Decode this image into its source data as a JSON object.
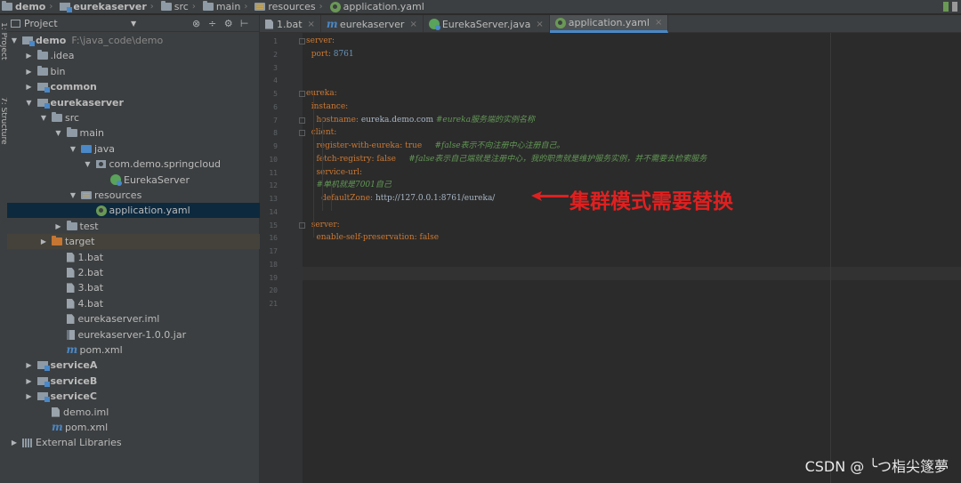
{
  "breadcrumb": [
    {
      "label": "demo",
      "icon": "folder-icon",
      "bold": true
    },
    {
      "label": "eurekaserver",
      "icon": "module-folder-icon",
      "bold": true
    },
    {
      "label": "src",
      "icon": "folder-icon",
      "bold": false
    },
    {
      "label": "main",
      "icon": "folder-icon",
      "bold": false
    },
    {
      "label": "resources",
      "icon": "resources-folder-icon",
      "bold": false
    },
    {
      "label": "application.yaml",
      "icon": "yaml-file-icon",
      "bold": false
    }
  ],
  "tool_strip": {
    "project_label": "1: Project",
    "structure_label": "7: Structure"
  },
  "project_panel": {
    "title": "Project",
    "tree": [
      {
        "label": "demo",
        "path": "F:\\java_code\\demo",
        "depth": 0,
        "arrow": "open",
        "icon": "module-folder-icon",
        "bold": true
      },
      {
        "label": ".idea",
        "depth": 1,
        "arrow": "closed",
        "icon": "folder-icon"
      },
      {
        "label": "bin",
        "depth": 1,
        "arrow": "closed",
        "icon": "folder-icon"
      },
      {
        "label": "common",
        "depth": 1,
        "arrow": "closed",
        "icon": "module-folder-icon",
        "bold": true
      },
      {
        "label": "eurekaserver",
        "depth": 1,
        "arrow": "open",
        "icon": "module-folder-icon",
        "bold": true
      },
      {
        "label": "src",
        "depth": 2,
        "arrow": "open",
        "icon": "folder-icon"
      },
      {
        "label": "main",
        "depth": 3,
        "arrow": "open",
        "icon": "folder-icon"
      },
      {
        "label": "java",
        "depth": 4,
        "arrow": "open",
        "icon": "java-source-folder-icon"
      },
      {
        "label": "com.demo.springcloud",
        "depth": 5,
        "arrow": "open",
        "icon": "package-icon"
      },
      {
        "label": "EurekaServer",
        "depth": 6,
        "arrow": "none",
        "icon": "spring-class-icon"
      },
      {
        "label": "resources",
        "depth": 4,
        "arrow": "open",
        "icon": "resources-folder-icon"
      },
      {
        "label": "application.yaml",
        "depth": 5,
        "arrow": "none",
        "icon": "yaml-file-icon",
        "selected": true
      },
      {
        "label": "test",
        "depth": 3,
        "arrow": "closed",
        "icon": "folder-icon"
      },
      {
        "label": "target",
        "depth": 2,
        "arrow": "closed",
        "icon": "excluded-folder-icon",
        "excluded": true
      },
      {
        "label": "1.bat",
        "depth": 3,
        "arrow": "none",
        "icon": "file-icon"
      },
      {
        "label": "2.bat",
        "depth": 3,
        "arrow": "none",
        "icon": "file-icon"
      },
      {
        "label": "3.bat",
        "depth": 3,
        "arrow": "none",
        "icon": "file-icon"
      },
      {
        "label": "4.bat",
        "depth": 3,
        "arrow": "none",
        "icon": "file-icon"
      },
      {
        "label": "eurekaserver.iml",
        "depth": 3,
        "arrow": "none",
        "icon": "iml-file-icon"
      },
      {
        "label": "eurekaserver-1.0.0.jar",
        "depth": 3,
        "arrow": "none",
        "icon": "jar-file-icon"
      },
      {
        "label": "pom.xml",
        "depth": 3,
        "arrow": "none",
        "icon": "maven-icon"
      },
      {
        "label": "serviceA",
        "depth": 1,
        "arrow": "closed",
        "icon": "module-folder-icon",
        "bold": true
      },
      {
        "label": "serviceB",
        "depth": 1,
        "arrow": "closed",
        "icon": "module-folder-icon",
        "bold": true
      },
      {
        "label": "serviceC",
        "depth": 1,
        "arrow": "closed",
        "icon": "module-folder-icon",
        "bold": true
      },
      {
        "label": "demo.iml",
        "depth": 2,
        "arrow": "none",
        "icon": "iml-file-icon"
      },
      {
        "label": "pom.xml",
        "depth": 2,
        "arrow": "none",
        "icon": "maven-icon"
      },
      {
        "label": "External Libraries",
        "depth": 0,
        "arrow": "closed",
        "icon": "libraries-icon"
      }
    ]
  },
  "tabs": [
    {
      "label": "1.bat",
      "icon": "file-icon",
      "active": false
    },
    {
      "label": "eurekaserver",
      "icon": "maven-icon",
      "active": false
    },
    {
      "label": "EurekaServer.java",
      "icon": "spring-class-icon",
      "active": false
    },
    {
      "label": "application.yaml",
      "icon": "yaml-file-icon",
      "active": true
    }
  ],
  "editor": {
    "lines": [
      {
        "no": "1",
        "tokens": [
          {
            "t": "server:",
            "c": "k"
          }
        ]
      },
      {
        "no": "2",
        "tokens": [
          {
            "t": "  port: ",
            "c": "k"
          },
          {
            "t": "8761",
            "c": "n"
          }
        ]
      },
      {
        "no": "3",
        "tokens": []
      },
      {
        "no": "4",
        "tokens": []
      },
      {
        "no": "5",
        "tokens": [
          {
            "t": "eureka:",
            "c": "k"
          }
        ]
      },
      {
        "no": "6",
        "tokens": [
          {
            "t": "  instance:",
            "c": "k"
          }
        ]
      },
      {
        "no": "7",
        "tokens": [
          {
            "t": "    hostname: ",
            "c": "k"
          },
          {
            "t": "eureka.demo.com ",
            "c": "v"
          },
          {
            "t": "#eureka服务端的实例名称",
            "c": "c"
          }
        ]
      },
      {
        "no": "8",
        "tokens": [
          {
            "t": "  client:",
            "c": "k"
          }
        ]
      },
      {
        "no": "9",
        "tokens": [
          {
            "t": "    register-with-eureka: ",
            "c": "k"
          },
          {
            "t": "true",
            "c": "k"
          },
          {
            "t": "     #false表示不向注册中心注册自己。",
            "c": "c"
          }
        ]
      },
      {
        "no": "10",
        "tokens": [
          {
            "t": "    fetch-registry: ",
            "c": "k"
          },
          {
            "t": "false",
            "c": "k"
          },
          {
            "t": "     #false表示自己端就是注册中心，我的职责就是维护服务实例，并不需要去检索服务",
            "c": "c"
          }
        ]
      },
      {
        "no": "11",
        "tokens": [
          {
            "t": "    service-url:",
            "c": "k"
          }
        ]
      },
      {
        "no": "12",
        "tokens": [
          {
            "t": "    #单机就是7001自己",
            "c": "c"
          }
        ]
      },
      {
        "no": "13",
        "tokens": [
          {
            "t": "      defaultZone: ",
            "c": "k"
          },
          {
            "t": "http://127.0.0.1:8761/eureka/",
            "c": "v"
          }
        ]
      },
      {
        "no": "14",
        "tokens": []
      },
      {
        "no": "15",
        "tokens": [
          {
            "t": "  server:",
            "c": "k"
          }
        ]
      },
      {
        "no": "16",
        "tokens": [
          {
            "t": "    enable-self-preservation: ",
            "c": "k"
          },
          {
            "t": "false",
            "c": "k"
          }
        ]
      },
      {
        "no": "17",
        "tokens": []
      },
      {
        "no": "18",
        "tokens": []
      },
      {
        "no": "19",
        "tokens": []
      },
      {
        "no": "20",
        "tokens": []
      },
      {
        "no": "21",
        "tokens": []
      }
    ]
  },
  "annotation": {
    "text": "集群模式需要替换",
    "color": "#e02020"
  },
  "watermark": "CSDN @ ╰つ栺尖篴夢",
  "colors": {
    "keyword": "#cc7832",
    "number": "#6897bb",
    "comment": "#629755",
    "value": "#a9b7c6",
    "selection": "#0d293e"
  }
}
